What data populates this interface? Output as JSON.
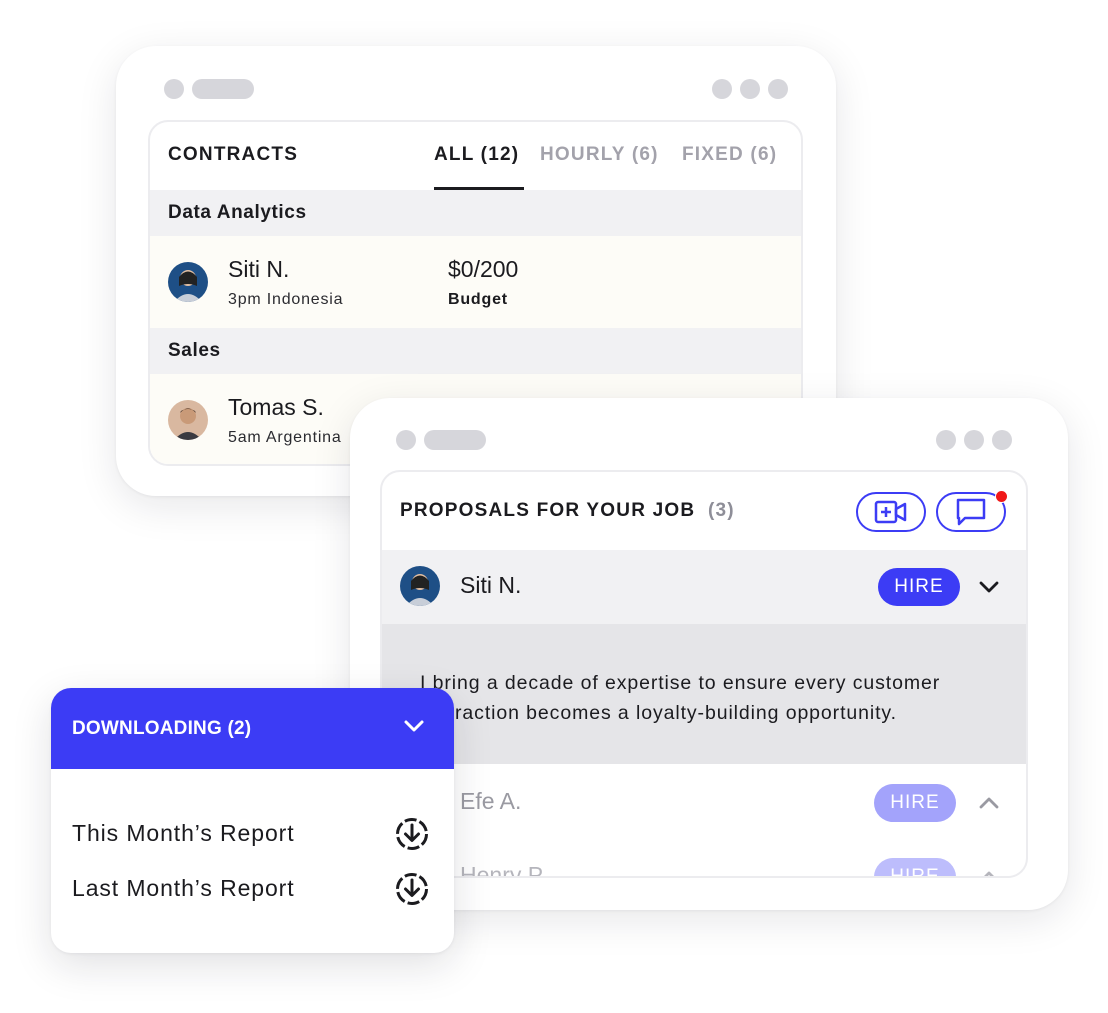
{
  "contracts": {
    "title": "CONTRACTS",
    "tabs": [
      {
        "label": "ALL (12)",
        "active": true
      },
      {
        "label": "HOURLY (6)",
        "active": false
      },
      {
        "label": "FIXED (6)",
        "active": false
      }
    ],
    "groups": [
      {
        "name": "Data Analytics",
        "person": {
          "name": "Siti N.",
          "detail": "3pm Indonesia"
        },
        "amount": "$0/200",
        "amount_label": "Budget"
      },
      {
        "name": "Sales",
        "person": {
          "name": "Tomas S.",
          "detail": "5am Argentina"
        }
      }
    ]
  },
  "proposals": {
    "title": "PROPOSALS FOR YOUR JOB",
    "count": "(3)",
    "actions": [
      "video-add-icon",
      "chat-icon"
    ],
    "has_notification": true,
    "items": [
      {
        "name": "Siti N.",
        "hire_label": "HIRE",
        "expanded": true,
        "message": "I bring a decade of expertise to ensure every customer interaction becomes a loyalty-building opportunity."
      },
      {
        "name": "Efe A.",
        "hire_label": "HIRE",
        "expanded": false
      },
      {
        "name": "Henry P.",
        "hire_label": "HIRE",
        "expanded": false
      }
    ]
  },
  "downloading": {
    "title": "DOWNLOADING (2)",
    "items": [
      {
        "label": "This Month’s Report",
        "icon": "download-progress-icon"
      },
      {
        "label": "Last Month’s Report",
        "icon": "download-progress-icon"
      }
    ]
  },
  "colors": {
    "accent": "#3c3cf5",
    "accent_faded": "#a3a3fb",
    "notification": "#f01818",
    "section_bg": "#f1f1f3",
    "row_bg": "#fdfcf7"
  }
}
